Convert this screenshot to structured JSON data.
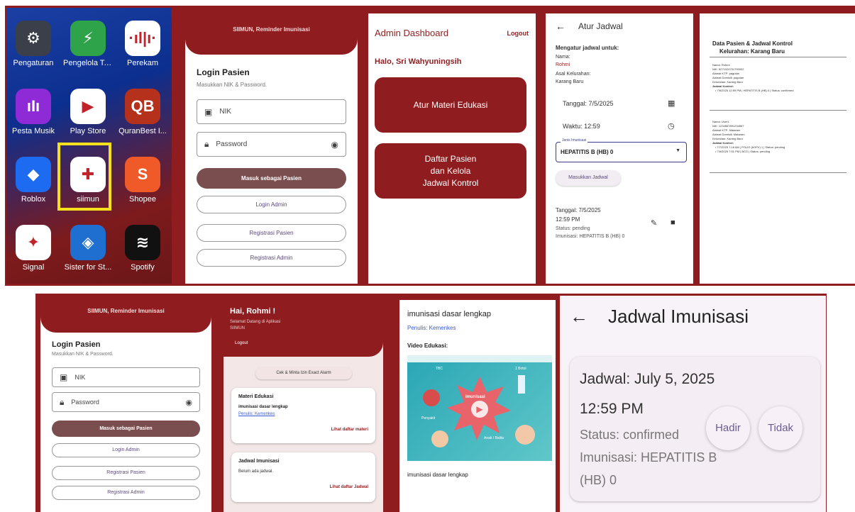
{
  "home": {
    "apps": [
      {
        "label": "Pengaturan",
        "icon": "gear-icon",
        "glyph": "⚙",
        "bg": "#3a3f4a"
      },
      {
        "label": "Pengelola Tele...",
        "icon": "shield-bolt-icon",
        "glyph": "⚡",
        "bg": "#2fa34a"
      },
      {
        "label": "Perekam",
        "icon": "recorder-icon",
        "glyph": "·ıl|ı·",
        "bg": "#ffffff"
      },
      {
        "label": "Pesta Musik",
        "icon": "music-icon",
        "glyph": "ıIı",
        "bg": "#8e2bd6"
      },
      {
        "label": "Play Store",
        "icon": "play-store-icon",
        "glyph": "▶",
        "bg": "#ffffff"
      },
      {
        "label": "QuranBest I...",
        "icon": "quran-icon",
        "glyph": "QB",
        "bg": "#b5311c"
      },
      {
        "label": "Roblox",
        "icon": "roblox-icon",
        "glyph": "◆",
        "bg": "#1d6bf0"
      },
      {
        "label": "siimun",
        "icon": "siimun-icon",
        "glyph": "✚",
        "bg": "#ffffff"
      },
      {
        "label": "Shopee",
        "icon": "shopee-icon",
        "glyph": "S",
        "bg": "#f05a28"
      },
      {
        "label": "Signal",
        "icon": "signal-icon",
        "glyph": "✦",
        "bg": "#ffffff"
      },
      {
        "label": "Sister for St...",
        "icon": "sister-icon",
        "glyph": "◈",
        "bg": "#1f6fd1"
      },
      {
        "label": "Spotify",
        "icon": "spotify-icon",
        "glyph": "≋",
        "bg": "#111111"
      }
    ]
  },
  "login": {
    "header": "SIIMUN, Reminder Imunisasi",
    "title": "Login Pasien",
    "subtitle": "Masukkan NIK & Password.",
    "nik_placeholder": "NIK",
    "password_placeholder": "Password",
    "btn_patient": "Masuk sebagai Pasien",
    "btn_admin": "Login Admin",
    "btn_reg_patient": "Registrasi Pasien",
    "btn_reg_admin": "Registrasi Admin"
  },
  "admin": {
    "title": "Admin Dashboard",
    "logout": "Logout",
    "greeting": "Halo, Sri Wahyuningsih",
    "btn_materi": "Atur Materi Edukasi",
    "btn_pasien_l1": "Daftar Pasien",
    "btn_pasien_l2": "dan Kelola",
    "btn_pasien_l3": "Jadwal Kontrol"
  },
  "schedule": {
    "title": "Atur Jadwal",
    "heading": "Mengatur jadwal untuk:",
    "nama_label": "Nama:",
    "nama": "Rohmi",
    "kel_label": "Asal Kelurahan:",
    "kel": "Karang Baru",
    "tanggal": "Tanggal: 7/5/2025",
    "waktu": "Waktu: 12:59",
    "jenis_label": "Jenis Imunisasi",
    "jenis": "HEPATITIS B (HB) 0",
    "btn_submit": "Masukkan Jadwal",
    "item_tanggal": "Tanggal: 7/5/2025",
    "item_waktu": "12:59 PM",
    "item_status": "Status: pending",
    "item_imunisasi": "Imunisasi: HEPATITIS B (HB) 0"
  },
  "report": {
    "title": "Data Pasien & Jadwal Kontrol",
    "subtitle": "Kelurahan: Karang Baru",
    "p1": [
      "Nama: Rohmi",
      "NIK: 5271024701790002",
      "Alamat KTP: pagutan",
      "Alamat Domisili: pagutan",
      "Kelurahan: Karang Baru"
    ],
    "p1_jadwal_label": "Jadwal Kontrol:",
    "p1_jadwal": [
      "• 7/6/2025 12:59 PM | HEPATITIS B (HB) 0 | Status: confirmed"
    ],
    "p2": [
      "Nama: User1",
      "NIK: 1234567891234567",
      "Alamat KTP: Mataram",
      "Alamat Domisili: Mataram",
      "Kelurahan: Karang Baru"
    ],
    "p2_jadwal_label": "Jadwal Kontrol:",
    "p2_jadwal": [
      "• 7/7/2025 7:18 AM | POLIO (bOPV) 1 | Status: pending",
      "• 7/6/2025 7:51 PM | BCG | Status: pending"
    ]
  },
  "udash": {
    "greeting": "Hai, Rohmi !",
    "welcome_l1": "Selamat Datang di Aplikasi",
    "welcome_l2": "SIIMUN",
    "logout": "Logout",
    "btn_alarm": "Cek & Minta Izin Exact Alarm",
    "materi_title": "Materi Edukasi",
    "materi_item": "imunisasi dasar lengkap",
    "materi_author": "Penulis: Kemenkes",
    "materi_link": "Lihat daftar materi",
    "jadwal_title": "Jadwal Imunisasi",
    "jadwal_empty": "Belum ada jadwal.",
    "jadwal_link": "Lihat daftar Jadwal"
  },
  "edu": {
    "title": "imunisasi dasar lengkap",
    "author": "Penulis: Kemenkes",
    "video_label": "Video Edukasi:",
    "video_center": "imunisasi",
    "video_tl": "TBC",
    "video_tr": "1 Botol",
    "video_bl": "Penyakit",
    "video_br": "Anak / Balita",
    "caption": "imunisasi dasar lengkap"
  },
  "jadwal": {
    "title": "Jadwal Imunisasi",
    "date": "Jadwal: July 5, 2025",
    "time": "12:59 PM",
    "status": "Status: confirmed",
    "imun_l1": "Imunisasi: HEPATITIS B",
    "imun_l2": "(HB) 0",
    "btn_hadir": "Hadir",
    "btn_tidak": "Tidak"
  },
  "colors": {
    "primary": "#8f1d1f",
    "muted_button": "#7a4e4f",
    "link": "#3a5bd9"
  }
}
